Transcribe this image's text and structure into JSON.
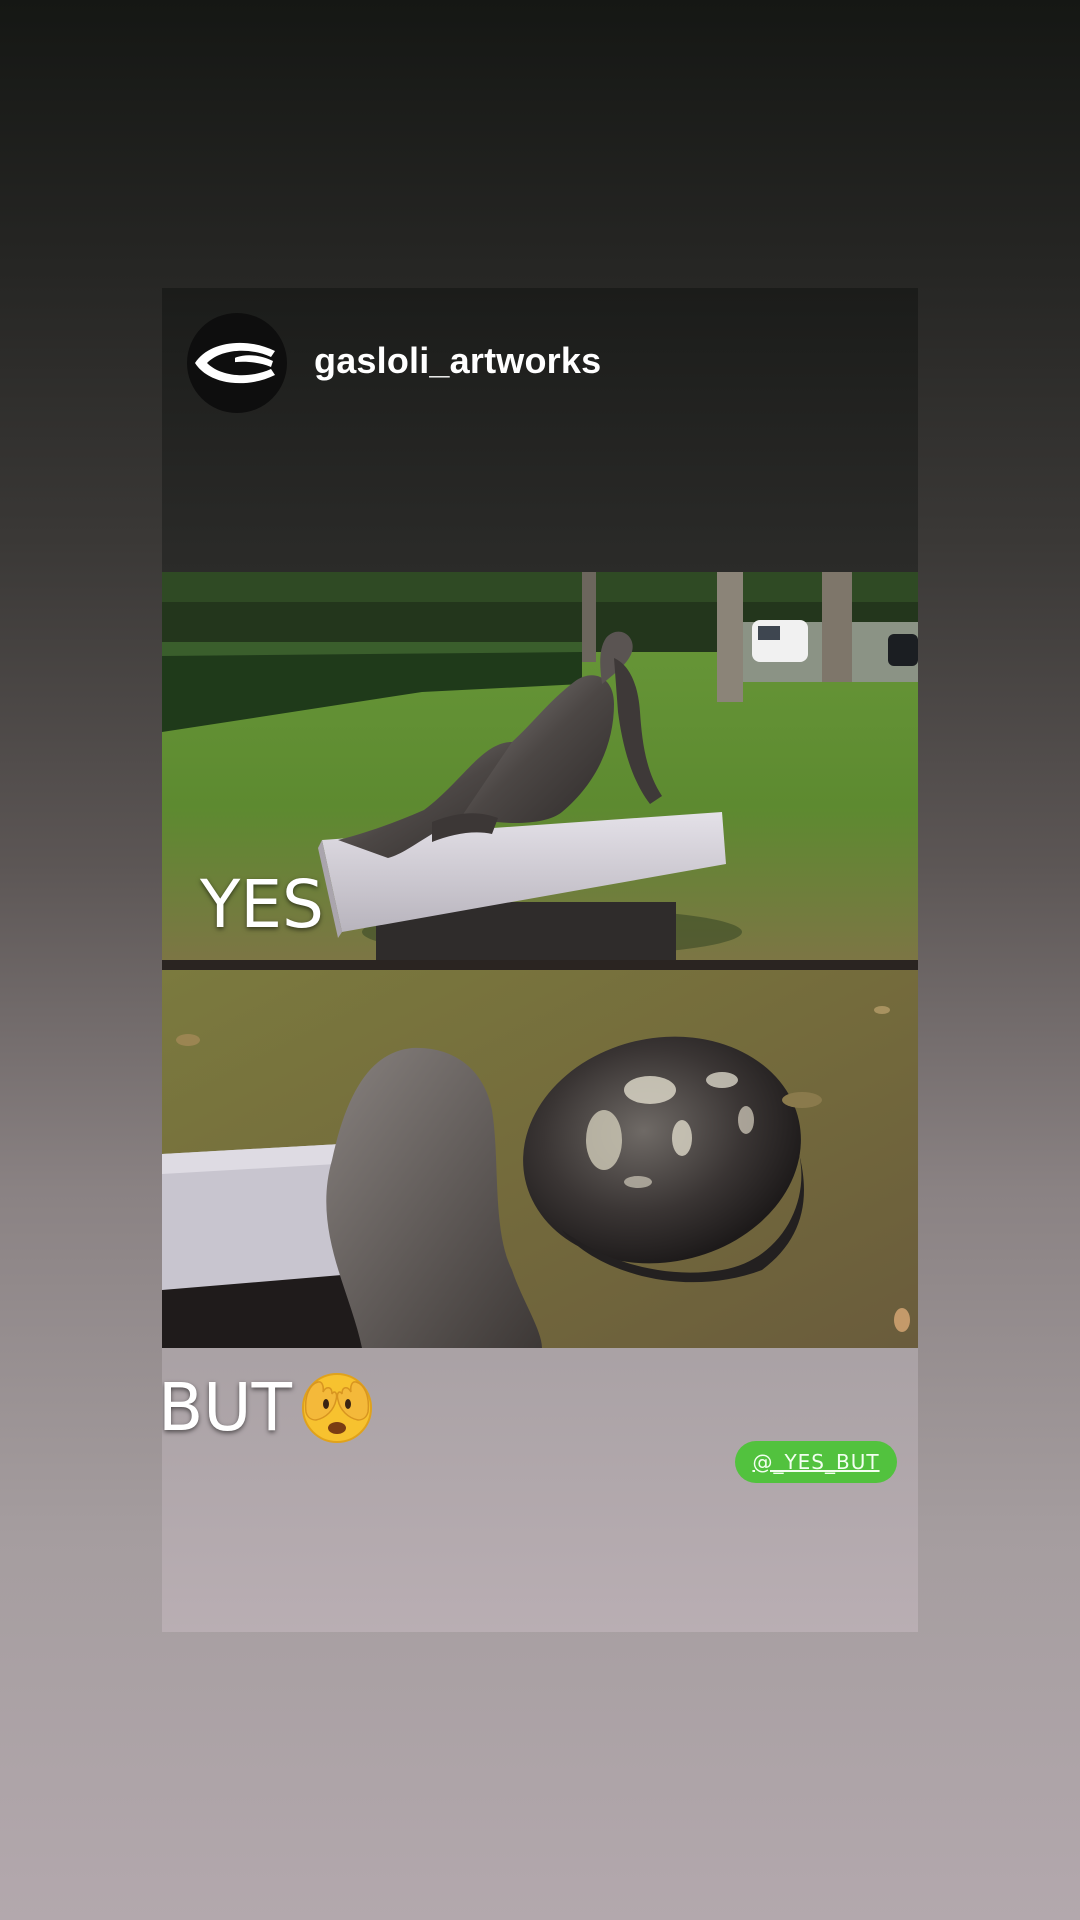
{
  "post": {
    "username": "gasloli_artworks",
    "avatar_icon": "gasloli-logo-icon"
  },
  "captions": {
    "top": "YES",
    "bottom": "BUT",
    "bottom_emoji": "face-with-hands-over-eyes-icon"
  },
  "mention_sticker": {
    "label": "@_YES_BUT",
    "color": "#52c23e"
  },
  "colors": {
    "caption_text": "#ffffff",
    "username_text": "#ffffff"
  }
}
